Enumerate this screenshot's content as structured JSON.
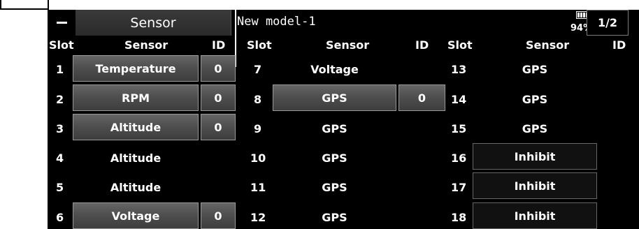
{
  "header": {
    "title": "Sensor",
    "model_name": "New model-1",
    "battery_percent": "94%",
    "battery_level": 0.94,
    "page": "1/2"
  },
  "columns": {
    "slot": "Slot",
    "sensor": "Sensor",
    "id": "ID"
  },
  "rows": [
    {
      "slot": "1",
      "sensor": "Temperature",
      "id": "0"
    },
    {
      "slot": "2",
      "sensor": "RPM",
      "id": "0"
    },
    {
      "slot": "3",
      "sensor": "Altitude",
      "id": "0"
    },
    {
      "slot": "4",
      "sensor": "Altitude"
    },
    {
      "slot": "5",
      "sensor": "Altitude"
    },
    {
      "slot": "6",
      "sensor": "Voltage",
      "id": "0"
    },
    {
      "slot": "7",
      "sensor": "Voltage"
    },
    {
      "slot": "8",
      "sensor": "GPS",
      "id": "0"
    },
    {
      "slot": "9",
      "sensor": "GPS"
    },
    {
      "slot": "10",
      "sensor": "GPS"
    },
    {
      "slot": "11",
      "sensor": "GPS"
    },
    {
      "slot": "12",
      "sensor": "GPS"
    },
    {
      "slot": "13",
      "sensor": "GPS"
    },
    {
      "slot": "14",
      "sensor": "GPS"
    },
    {
      "slot": "15",
      "sensor": "GPS"
    },
    {
      "slot": "16",
      "sensor": "Inhibit"
    },
    {
      "slot": "17",
      "sensor": "Inhibit"
    },
    {
      "slot": "18",
      "sensor": "Inhibit"
    }
  ]
}
